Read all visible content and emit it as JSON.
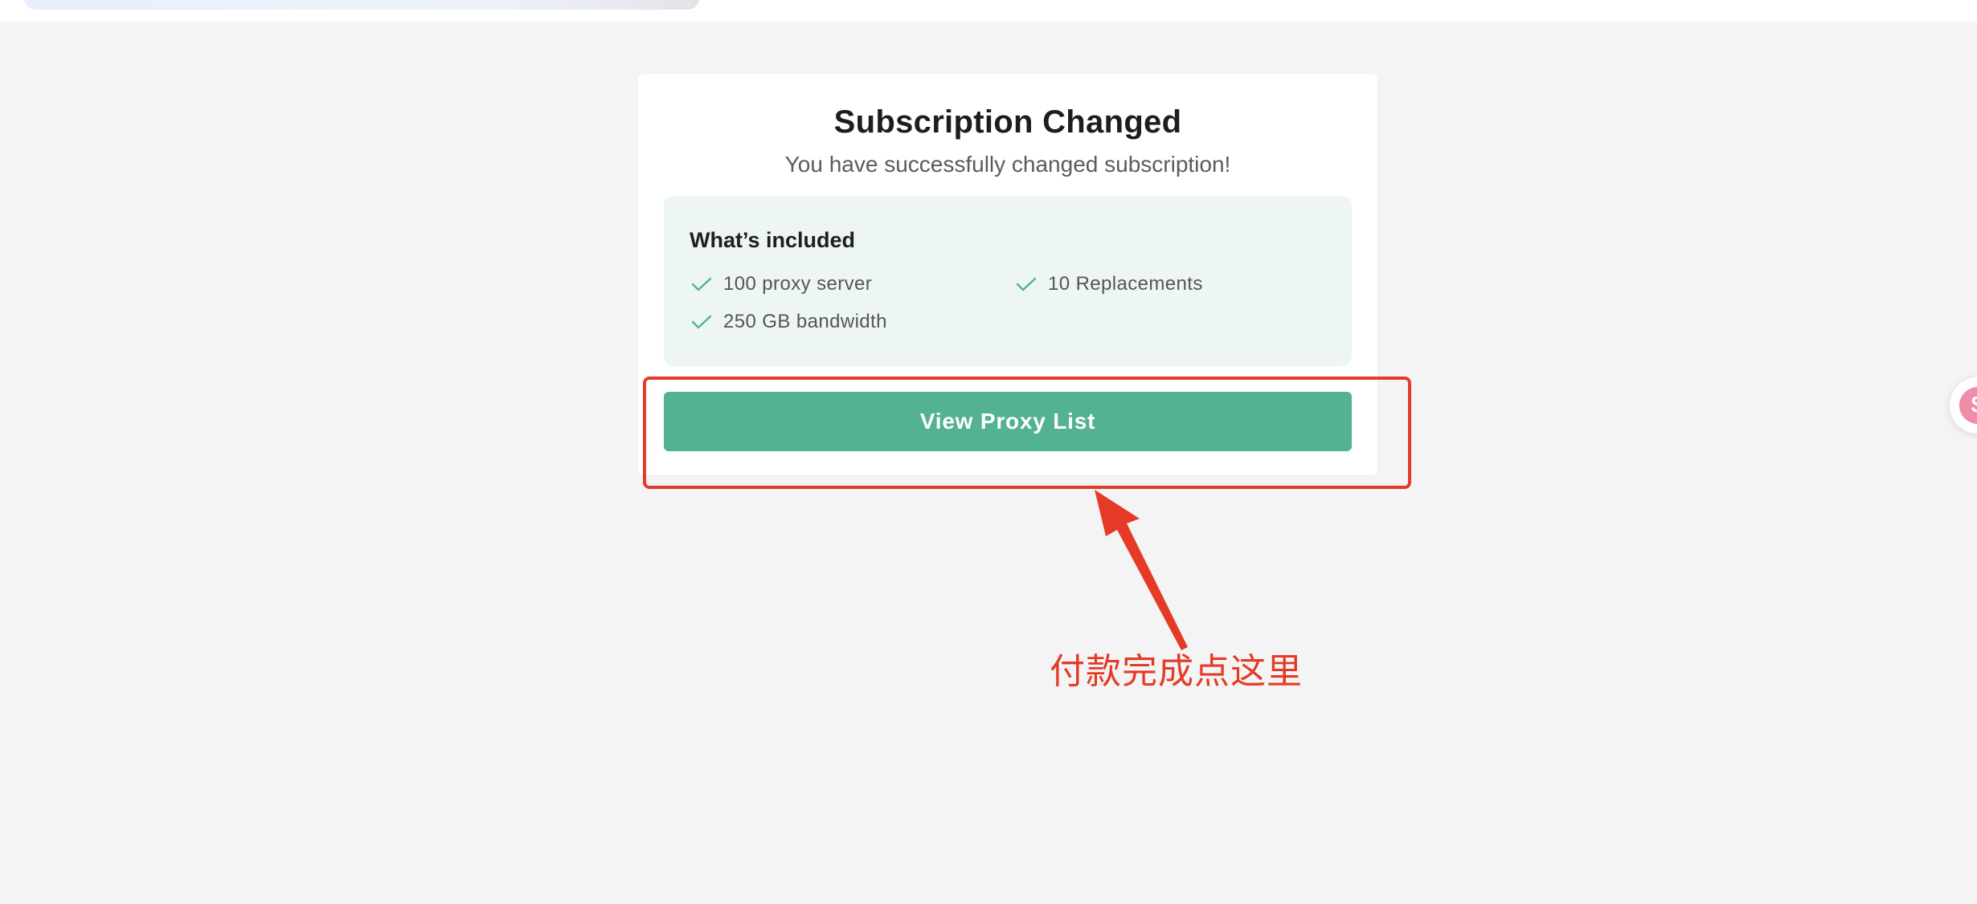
{
  "card": {
    "title": "Subscription Changed",
    "subtitle": "You have successfully changed subscription!",
    "included": {
      "heading": "What’s included",
      "features": [
        {
          "label": "100 proxy server",
          "icon": "check-icon"
        },
        {
          "label": "10 Replacements",
          "icon": "check-icon"
        },
        {
          "label": "250 GB bandwidth",
          "icon": "check-icon"
        }
      ]
    },
    "button_label": "View Proxy List"
  },
  "annotation": {
    "text": "付款完成点这里",
    "color": "#e53a26"
  },
  "side_widget": {
    "glyph": "$",
    "icon": "dollar-coin-icon"
  },
  "colors": {
    "accent": "#53b294",
    "included_bg": "#eef6f2",
    "page_bg": "#f4f4f4",
    "annotation": "#e53a26"
  }
}
